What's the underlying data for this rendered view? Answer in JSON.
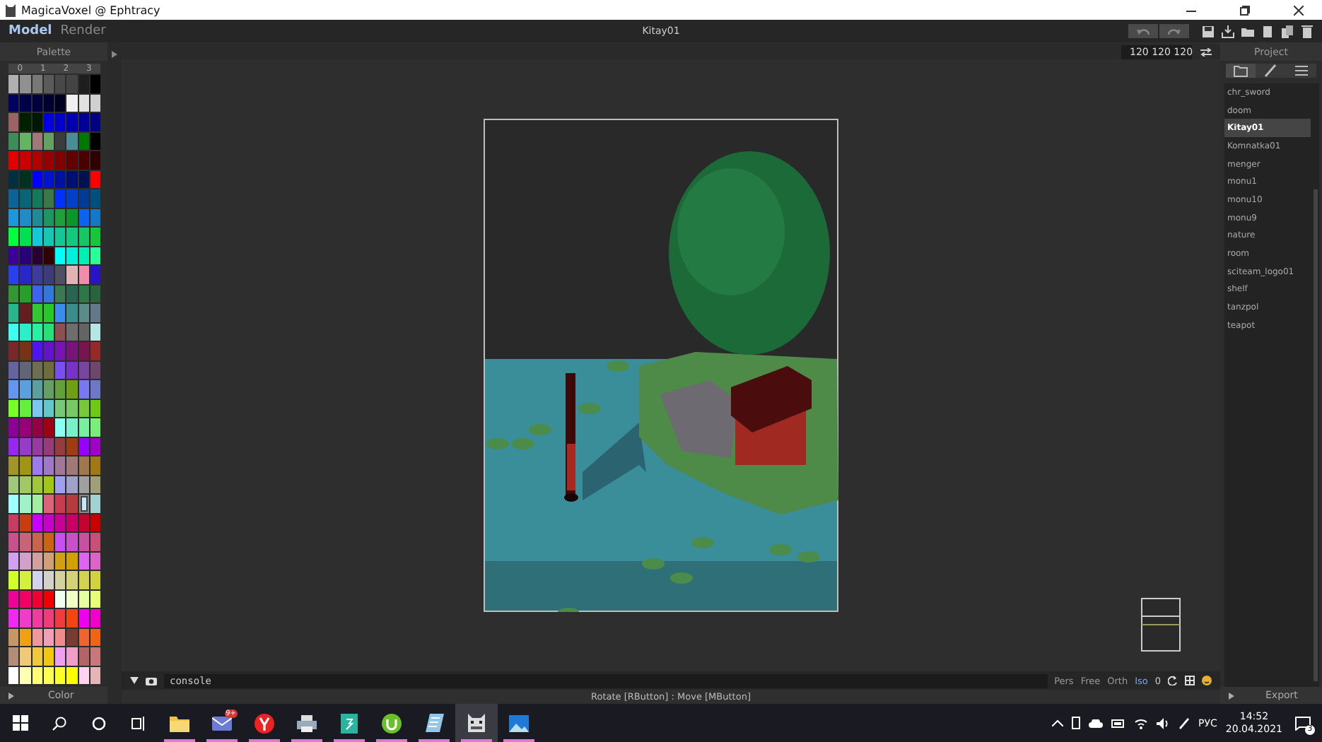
{
  "window": {
    "title": "MagicaVoxel @ Ephtracy"
  },
  "mode_tabs": [
    {
      "label": "Model",
      "selected": true
    },
    {
      "label": "Render",
      "selected": false
    }
  ],
  "document_title": "Kitay01",
  "history_buttons": [
    {
      "kind": "undo",
      "disabled": true
    },
    {
      "kind": "redo",
      "disabled": true
    }
  ],
  "file_buttons": [
    {
      "kind": "save"
    },
    {
      "kind": "export"
    },
    {
      "kind": "open"
    },
    {
      "kind": "new"
    },
    {
      "kind": "copy"
    },
    {
      "kind": "delete"
    }
  ],
  "palette": {
    "title": "Palette",
    "column_labels": [
      "0",
      "1",
      "2",
      "3"
    ],
    "footer": "Color",
    "rows": [
      {
        "swatches": [
          {
            "color": "#b0b0b0",
            "selected": false
          },
          {
            "color": "#909090",
            "selected": false
          },
          {
            "color": "#787878",
            "selected": false
          },
          {
            "color": "#5a5a5a",
            "selected": false
          },
          {
            "color": "#484848",
            "selected": false
          },
          {
            "color": "#444444",
            "selected": false
          },
          {
            "color": "#1e1e1e",
            "selected": false
          },
          {
            "color": "#000000",
            "selected": false
          }
        ]
      },
      {
        "swatches": [
          {
            "color": "#000060",
            "selected": false
          },
          {
            "color": "#00004a",
            "selected": false
          },
          {
            "color": "#000040",
            "selected": false
          },
          {
            "color": "#000030",
            "selected": false
          },
          {
            "color": "#000020",
            "selected": false
          },
          {
            "color": "#f0f0f0",
            "selected": false
          },
          {
            "color": "#e0e0e0",
            "selected": false
          },
          {
            "color": "#d0d0d0",
            "selected": false
          }
        ]
      },
      {
        "swatches": [
          {
            "color": "#9a6464",
            "selected": false
          },
          {
            "color": "#002000",
            "selected": false
          },
          {
            "color": "#001800",
            "selected": false
          },
          {
            "color": "#0000e0",
            "selected": false
          },
          {
            "color": "#0000c8",
            "selected": false
          },
          {
            "color": "#0000b0",
            "selected": false
          },
          {
            "color": "#000098",
            "selected": false
          },
          {
            "color": "#000080",
            "selected": false
          }
        ]
      },
      {
        "swatches": [
          {
            "color": "#3c8c5c",
            "selected": false
          },
          {
            "color": "#64b464",
            "selected": false
          },
          {
            "color": "#a07878",
            "selected": false
          },
          {
            "color": "#64a064",
            "selected": false
          },
          {
            "color": "#3c3c3c",
            "selected": false
          },
          {
            "color": "#4b8c96",
            "selected": false
          },
          {
            "color": "#007800",
            "selected": false
          },
          {
            "color": "#000000",
            "selected": false
          }
        ]
      },
      {
        "swatches": [
          {
            "color": "#e00000",
            "selected": false
          },
          {
            "color": "#c80000",
            "selected": false
          },
          {
            "color": "#b00000",
            "selected": false
          },
          {
            "color": "#960000",
            "selected": false
          },
          {
            "color": "#800000",
            "selected": false
          },
          {
            "color": "#600000",
            "selected": false
          },
          {
            "color": "#480000",
            "selected": false
          },
          {
            "color": "#300000",
            "selected": false
          }
        ]
      },
      {
        "swatches": [
          {
            "color": "#003040",
            "selected": false
          },
          {
            "color": "#003020",
            "selected": false
          },
          {
            "color": "#0000ff",
            "selected": false
          },
          {
            "color": "#0014d0",
            "selected": false
          },
          {
            "color": "#0010a0",
            "selected": false
          },
          {
            "color": "#001070",
            "selected": false
          },
          {
            "color": "#001050",
            "selected": false
          },
          {
            "color": "#ff0000",
            "selected": false
          }
        ]
      },
      {
        "swatches": [
          {
            "color": "#0a6496",
            "selected": false
          },
          {
            "color": "#0a6478",
            "selected": false
          },
          {
            "color": "#14785a",
            "selected": false
          },
          {
            "color": "#3c7846",
            "selected": false
          },
          {
            "color": "#0032ff",
            "selected": false
          },
          {
            "color": "#0040c8",
            "selected": false
          },
          {
            "color": "#003c96",
            "selected": false
          },
          {
            "color": "#00507f",
            "selected": false
          }
        ]
      },
      {
        "swatches": [
          {
            "color": "#1e96dc",
            "selected": false
          },
          {
            "color": "#1e8cc8",
            "selected": false
          },
          {
            "color": "#1e8c96",
            "selected": false
          },
          {
            "color": "#1e9664",
            "selected": false
          },
          {
            "color": "#1ea03c",
            "selected": false
          },
          {
            "color": "#0a9628",
            "selected": false
          },
          {
            "color": "#0a64f0",
            "selected": false
          },
          {
            "color": "#1478c8",
            "selected": false
          }
        ]
      },
      {
        "swatches": [
          {
            "color": "#00ff3c",
            "selected": false
          },
          {
            "color": "#00e050",
            "selected": false
          },
          {
            "color": "#14c8dc",
            "selected": false
          },
          {
            "color": "#14c8b4",
            "selected": false
          },
          {
            "color": "#14c896",
            "selected": false
          },
          {
            "color": "#14c87d",
            "selected": false
          },
          {
            "color": "#14c864",
            "selected": false
          },
          {
            "color": "#14c83c",
            "selected": false
          }
        ]
      },
      {
        "swatches": [
          {
            "color": "#3c0096",
            "selected": false
          },
          {
            "color": "#280078",
            "selected": false
          },
          {
            "color": "#280032",
            "selected": false
          },
          {
            "color": "#320000",
            "selected": false
          },
          {
            "color": "#00ffff",
            "selected": false
          },
          {
            "color": "#00f0dc",
            "selected": false
          },
          {
            "color": "#00f0b4",
            "selected": false
          },
          {
            "color": "#28ff96",
            "selected": false
          }
        ]
      },
      {
        "swatches": [
          {
            "color": "#2840f0",
            "selected": false
          },
          {
            "color": "#2828c8",
            "selected": false
          },
          {
            "color": "#3c3c9c",
            "selected": false
          },
          {
            "color": "#3c3c78",
            "selected": false
          },
          {
            "color": "#505064",
            "selected": false
          },
          {
            "color": "#e0b4b4",
            "selected": false
          },
          {
            "color": "#f08caa",
            "selected": false
          },
          {
            "color": "#2814c8",
            "selected": false
          }
        ]
      },
      {
        "swatches": [
          {
            "color": "#329632",
            "selected": false
          },
          {
            "color": "#28a028",
            "selected": false
          },
          {
            "color": "#3c64f0",
            "selected": false
          },
          {
            "color": "#3278dc",
            "selected": false
          },
          {
            "color": "#3c7850",
            "selected": false
          },
          {
            "color": "#286450",
            "selected": false
          },
          {
            "color": "#2d7846",
            "selected": false
          },
          {
            "color": "#28643c",
            "selected": false
          }
        ]
      },
      {
        "swatches": [
          {
            "color": "#28b48c",
            "selected": false
          },
          {
            "color": "#641e1e",
            "selected": false
          },
          {
            "color": "#32c832",
            "selected": false
          },
          {
            "color": "#28c828",
            "selected": false
          },
          {
            "color": "#3c8cf0",
            "selected": false
          },
          {
            "color": "#3c8c8c",
            "selected": false
          },
          {
            "color": "#5a8c8c",
            "selected": false
          },
          {
            "color": "#64788c",
            "selected": false
          }
        ]
      },
      {
        "swatches": [
          {
            "color": "#3cfff0",
            "selected": false
          },
          {
            "color": "#28f0c8",
            "selected": false
          },
          {
            "color": "#28f0a0",
            "selected": false
          },
          {
            "color": "#28e078",
            "selected": false
          },
          {
            "color": "#8c5050",
            "selected": false
          },
          {
            "color": "#6e6e6e",
            "selected": false
          },
          {
            "color": "#646464",
            "selected": false
          },
          {
            "color": "#b4e6e6",
            "selected": false
          }
        ]
      },
      {
        "swatches": [
          {
            "color": "#782828",
            "selected": false
          },
          {
            "color": "#783214",
            "selected": false
          },
          {
            "color": "#5014f0",
            "selected": false
          },
          {
            "color": "#6414c8",
            "selected": false
          },
          {
            "color": "#7814b4",
            "selected": false
          },
          {
            "color": "#781478",
            "selected": false
          },
          {
            "color": "#781450",
            "selected": false
          },
          {
            "color": "#962828",
            "selected": false
          }
        ]
      },
      {
        "swatches": [
          {
            "color": "#6464a0",
            "selected": false
          },
          {
            "color": "#646478",
            "selected": false
          },
          {
            "color": "#6e6e50",
            "selected": false
          },
          {
            "color": "#6e6e3c",
            "selected": false
          },
          {
            "color": "#7850f0",
            "selected": false
          },
          {
            "color": "#7832c8",
            "selected": false
          },
          {
            "color": "#7846a0",
            "selected": false
          },
          {
            "color": "#6e466e",
            "selected": false
          }
        ]
      },
      {
        "swatches": [
          {
            "color": "#6496f0",
            "selected": false
          },
          {
            "color": "#5aa0dc",
            "selected": false
          },
          {
            "color": "#5aa0a0",
            "selected": false
          },
          {
            "color": "#64a064",
            "selected": false
          },
          {
            "color": "#64a03c",
            "selected": false
          },
          {
            "color": "#6ea014",
            "selected": false
          },
          {
            "color": "#7878f0",
            "selected": false
          },
          {
            "color": "#6e78c8",
            "selected": false
          }
        ]
      },
      {
        "swatches": [
          {
            "color": "#78ff28",
            "selected": false
          },
          {
            "color": "#64f03c",
            "selected": false
          },
          {
            "color": "#78c8f0",
            "selected": false
          },
          {
            "color": "#64c8c8",
            "selected": false
          },
          {
            "color": "#78c878",
            "selected": false
          },
          {
            "color": "#78c864",
            "selected": false
          },
          {
            "color": "#78c83c",
            "selected": false
          },
          {
            "color": "#6ec814",
            "selected": false
          }
        ]
      },
      {
        "swatches": [
          {
            "color": "#8c0096",
            "selected": false
          },
          {
            "color": "#960078",
            "selected": false
          },
          {
            "color": "#960046",
            "selected": false
          },
          {
            "color": "#a00014",
            "selected": false
          },
          {
            "color": "#8cfff0",
            "selected": false
          },
          {
            "color": "#78f0c8",
            "selected": false
          },
          {
            "color": "#78f0a0",
            "selected": false
          },
          {
            "color": "#78f078",
            "selected": false
          }
        ]
      },
      {
        "swatches": [
          {
            "color": "#9628f0",
            "selected": false
          },
          {
            "color": "#963cc8",
            "selected": false
          },
          {
            "color": "#963ca0",
            "selected": false
          },
          {
            "color": "#963c78",
            "selected": false
          },
          {
            "color": "#963c3c",
            "selected": false
          },
          {
            "color": "#a03c14",
            "selected": false
          },
          {
            "color": "#9600ff",
            "selected": false
          },
          {
            "color": "#a000c8",
            "selected": false
          }
        ]
      },
      {
        "swatches": [
          {
            "color": "#a09628",
            "selected": false
          },
          {
            "color": "#a09614",
            "selected": false
          },
          {
            "color": "#a078f0",
            "selected": false
          },
          {
            "color": "#a078c8",
            "selected": false
          },
          {
            "color": "#a07896",
            "selected": false
          },
          {
            "color": "#a07878",
            "selected": false
          },
          {
            "color": "#a07850",
            "selected": false
          },
          {
            "color": "#a07814",
            "selected": false
          }
        ]
      },
      {
        "swatches": [
          {
            "color": "#a0c878",
            "selected": false
          },
          {
            "color": "#a0c864",
            "selected": false
          },
          {
            "color": "#a0c83c",
            "selected": false
          },
          {
            "color": "#a0c814",
            "selected": false
          },
          {
            "color": "#a0a0f0",
            "selected": false
          },
          {
            "color": "#a0a0c8",
            "selected": false
          },
          {
            "color": "#a0a0a0",
            "selected": false
          },
          {
            "color": "#a0a078",
            "selected": false
          }
        ]
      },
      {
        "swatches": [
          {
            "color": "#a0ffff",
            "selected": false
          },
          {
            "color": "#a0f0c8",
            "selected": false
          },
          {
            "color": "#a0f0a0",
            "selected": false
          },
          {
            "color": "#dc6478",
            "selected": false
          },
          {
            "color": "#c83c50",
            "selected": false
          },
          {
            "color": "#b43c3c",
            "selected": false
          },
          {
            "color": "#c8e6ff",
            "selected": true
          },
          {
            "color": "#a0d2d2",
            "selected": false
          }
        ]
      },
      {
        "swatches": [
          {
            "color": "#c83c64",
            "selected": false
          },
          {
            "color": "#c83c14",
            "selected": false
          },
          {
            "color": "#c800ff",
            "selected": false
          },
          {
            "color": "#c800c8",
            "selected": false
          },
          {
            "color": "#c80096",
            "selected": false
          },
          {
            "color": "#c80064",
            "selected": false
          },
          {
            "color": "#c80032",
            "selected": false
          },
          {
            "color": "#c80000",
            "selected": false
          }
        ]
      },
      {
        "swatches": [
          {
            "color": "#c8508c",
            "selected": false
          },
          {
            "color": "#c86478",
            "selected": false
          },
          {
            "color": "#c86450",
            "selected": false
          },
          {
            "color": "#c86414",
            "selected": false
          },
          {
            "color": "#c850f0",
            "selected": false
          },
          {
            "color": "#c850c8",
            "selected": false
          },
          {
            "color": "#c850a0",
            "selected": false
          },
          {
            "color": "#c85078",
            "selected": false
          }
        ]
      },
      {
        "swatches": [
          {
            "color": "#d2a0f0",
            "selected": false
          },
          {
            "color": "#d2a0c8",
            "selected": false
          },
          {
            "color": "#d2a0a0",
            "selected": false
          },
          {
            "color": "#d2a078",
            "selected": false
          },
          {
            "color": "#d2a014",
            "selected": false
          },
          {
            "color": "#d2a000",
            "selected": false
          },
          {
            "color": "#dc64f0",
            "selected": false
          },
          {
            "color": "#dc64c8",
            "selected": false
          }
        ]
      },
      {
        "swatches": [
          {
            "color": "#d2ff28",
            "selected": false
          },
          {
            "color": "#d2f03c",
            "selected": false
          },
          {
            "color": "#d2d2f0",
            "selected": false
          },
          {
            "color": "#d2d2c8",
            "selected": false
          },
          {
            "color": "#d2d2a0",
            "selected": false
          },
          {
            "color": "#d2d278",
            "selected": false
          },
          {
            "color": "#d2d250",
            "selected": false
          },
          {
            "color": "#d2d23c",
            "selected": false
          }
        ]
      },
      {
        "swatches": [
          {
            "color": "#f00096",
            "selected": false
          },
          {
            "color": "#f00064",
            "selected": false
          },
          {
            "color": "#f00032",
            "selected": false
          },
          {
            "color": "#f00000",
            "selected": false
          },
          {
            "color": "#f0fff0",
            "selected": false
          },
          {
            "color": "#f0ffc8",
            "selected": false
          },
          {
            "color": "#e6ffa0",
            "selected": false
          },
          {
            "color": "#e6ff78",
            "selected": false
          }
        ]
      },
      {
        "swatches": [
          {
            "color": "#f028f0",
            "selected": false
          },
          {
            "color": "#f03cc8",
            "selected": false
          },
          {
            "color": "#f03ca0",
            "selected": false
          },
          {
            "color": "#f03c78",
            "selected": false
          },
          {
            "color": "#f03c3c",
            "selected": false
          },
          {
            "color": "#f04614",
            "selected": false
          },
          {
            "color": "#f000f0",
            "selected": false
          },
          {
            "color": "#f000c8",
            "selected": false
          }
        ]
      },
      {
        "swatches": [
          {
            "color": "#c89664",
            "selected": false
          },
          {
            "color": "#f0a014",
            "selected": false
          },
          {
            "color": "#f096a0",
            "selected": false
          },
          {
            "color": "#f0a0b4",
            "selected": false
          },
          {
            "color": "#f08c8c",
            "selected": false
          },
          {
            "color": "#783c32",
            "selected": false
          },
          {
            "color": "#f06432",
            "selected": false
          },
          {
            "color": "#f06414",
            "selected": false
          }
        ]
      },
      {
        "swatches": [
          {
            "color": "#b48c78",
            "selected": false
          },
          {
            "color": "#f0c878",
            "selected": false
          },
          {
            "color": "#f0c83c",
            "selected": false
          },
          {
            "color": "#f0c814",
            "selected": false
          },
          {
            "color": "#f0a0f0",
            "selected": false
          },
          {
            "color": "#f0a0c8",
            "selected": false
          },
          {
            "color": "#b46464",
            "selected": false
          },
          {
            "color": "#c87878",
            "selected": false
          }
        ]
      },
      {
        "swatches": [
          {
            "color": "#ffffff",
            "selected": false
          },
          {
            "color": "#ffffb4",
            "selected": false
          },
          {
            "color": "#ffff78",
            "selected": false
          },
          {
            "color": "#ffff50",
            "selected": false
          },
          {
            "color": "#ffff28",
            "selected": false
          },
          {
            "color": "#ffff00",
            "selected": false
          },
          {
            "color": "#ffd2f0",
            "selected": false
          },
          {
            "color": "#e6b4b4",
            "selected": false
          }
        ]
      }
    ]
  },
  "viewport": {
    "dimensions": "120 120 120",
    "console": {
      "value": "console"
    },
    "camera_modes": [
      {
        "label": "Pers",
        "selected": false
      },
      {
        "label": "Free",
        "selected": false
      },
      {
        "label": "Orth",
        "selected": false
      },
      {
        "label": "Iso",
        "selected": true
      }
    ],
    "zoom_reading": "0",
    "status": "Rotate [RButton] : Move [MButton]"
  },
  "project": {
    "title": "Project",
    "footer": "Export",
    "tabs": [
      {
        "kind": "folder",
        "selected": true
      },
      {
        "kind": "brush",
        "selected": false
      },
      {
        "kind": "list",
        "selected": false
      }
    ],
    "files": [
      {
        "label": "chr_sword",
        "selected": false
      },
      {
        "label": "doom",
        "selected": false
      },
      {
        "label": "Kitay01",
        "selected": true
      },
      {
        "label": "Komnatka01",
        "selected": false
      },
      {
        "label": "menger",
        "selected": false
      },
      {
        "label": "monu1",
        "selected": false
      },
      {
        "label": "monu10",
        "selected": false
      },
      {
        "label": "monu9",
        "selected": false
      },
      {
        "label": "nature",
        "selected": false
      },
      {
        "label": "room",
        "selected": false
      },
      {
        "label": "sciteam_logo01",
        "selected": false
      },
      {
        "label": "shelf",
        "selected": false
      },
      {
        "label": "tanzpol",
        "selected": false
      },
      {
        "label": "teapot",
        "selected": false
      }
    ]
  },
  "taskbar": {
    "apps": [
      {
        "kind": "folder",
        "selected": false
      },
      {
        "kind": "mail",
        "selected": false,
        "badge": "9+"
      },
      {
        "kind": "browser",
        "selected": false
      },
      {
        "kind": "printer",
        "selected": false
      },
      {
        "kind": "sheet",
        "selected": false
      },
      {
        "kind": "torrent",
        "selected": false
      },
      {
        "kind": "notes",
        "selected": false
      },
      {
        "kind": "voxel",
        "selected": true
      },
      {
        "kind": "photos",
        "selected": false
      }
    ],
    "language": "РУС",
    "time": "14:52",
    "date": "20.04.2021",
    "notifications": "3"
  }
}
